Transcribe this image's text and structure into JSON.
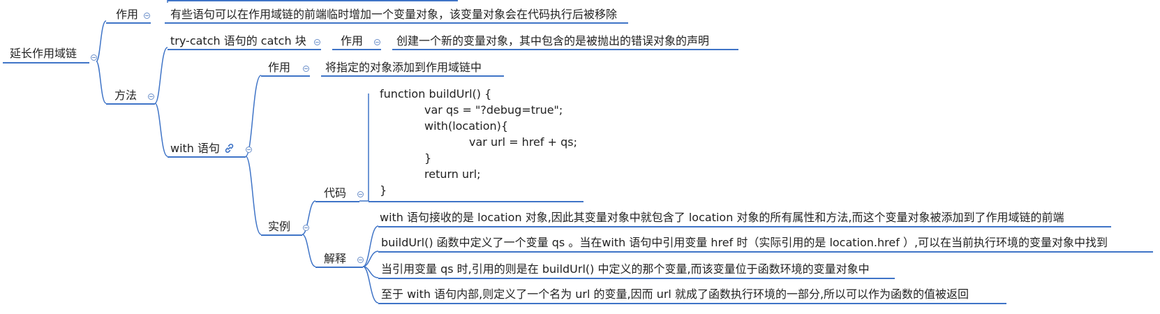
{
  "root": {
    "label": "延长作用域链"
  },
  "purpose": {
    "label": "作用",
    "text": "有些语句可以在作用域链的前端临时增加一个变量对象，该变量对象会在代码执行后被移除"
  },
  "methods": {
    "label": "方法",
    "try_catch": {
      "label": "try-catch 语句的 catch 块",
      "purpose_label": "作用",
      "purpose_text": "创建一个新的变量对象，其中包含的是被抛出的错误对象的声明"
    },
    "with": {
      "label": "with 语句",
      "link_icon": "link-icon",
      "purpose_label": "作用",
      "purpose_text": "将指定的对象添加到作用域链中",
      "example": {
        "label": "实例",
        "code_label": "代码",
        "code_lines": [
          "function buildUrl() {",
          "var qs = \"?debug=true\";",
          "with(location){",
          "var url = href + qs;",
          "}",
          "return url;",
          "}"
        ],
        "explain_label": "解释",
        "explanations": [
          " with 语句接收的是 location 对象,因此其变量对象中就包含了 location 对象的所有属性和方法,而这个变量对象被添加到了作用域链的前端",
          "buildUrl() 函数中定义了一个变量 qs 。当在with 语句中引用变量 href 时（实际引用的是 location.href ）,可以在当前执行环境的变量对象中找到",
          "当引用变量 qs 时,引用的则是在 buildUrl() 中定义的那个变量,而该变量位于函数环境的变量对象中",
          "至于 with 语句内部,则定义了一个名为 url 的变量,因而 url 就成了函数执行环境的一部分,所以可以作为函数的值被返回"
        ]
      }
    }
  },
  "colors": {
    "line": "#3f74c7",
    "toggle": "#6b8fc9",
    "text": "#222222"
  }
}
